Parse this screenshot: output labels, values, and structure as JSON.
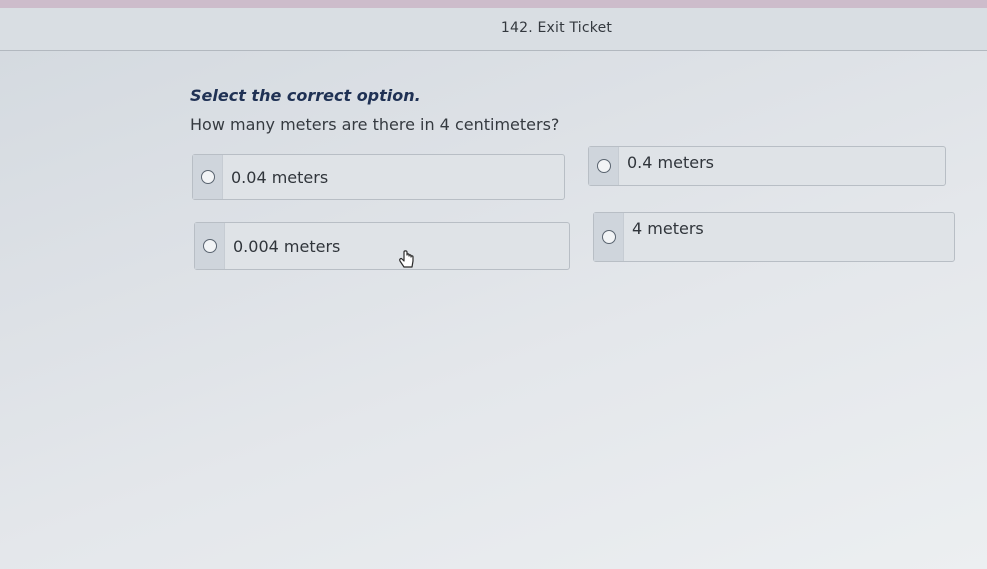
{
  "header": {
    "title": "142. Exit Ticket"
  },
  "question": {
    "instruction": "Select the correct option.",
    "prompt": "How many meters are there in 4 centimeters?"
  },
  "options": [
    {
      "label": "0.04 meters"
    },
    {
      "label": "0.4 meters"
    },
    {
      "label": "0.004 meters"
    },
    {
      "label": "4 meters"
    }
  ],
  "icons": {
    "radio": "radio-empty-icon",
    "cursor": "hand-pointer-icon"
  }
}
